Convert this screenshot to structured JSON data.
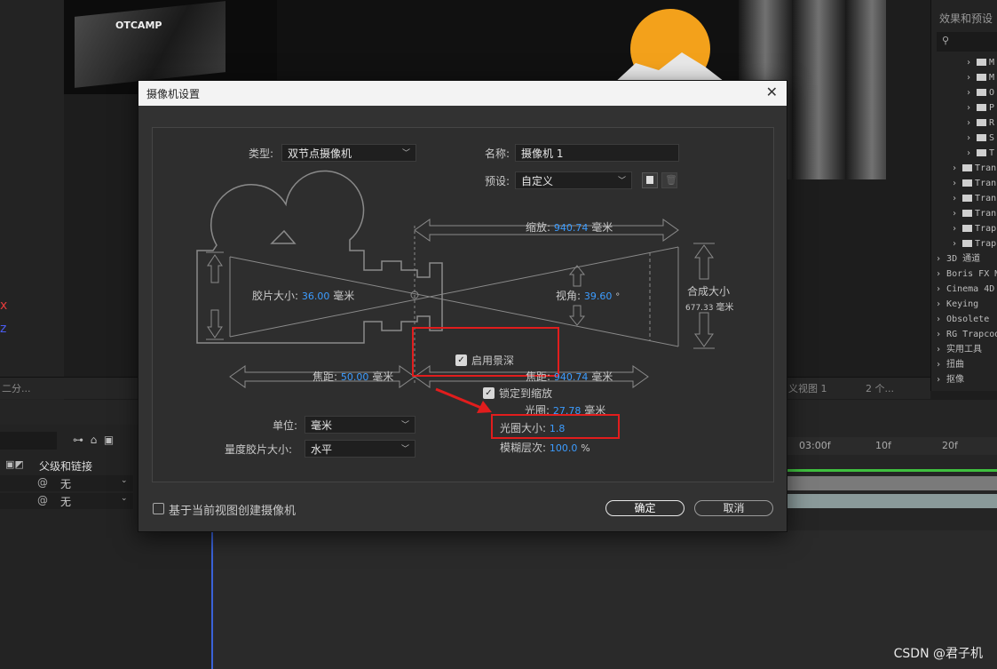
{
  "background": {
    "thumb_logo": "OTCAMP",
    "axis_x": "x",
    "axis_z": "z",
    "right_panel": {
      "title": "效果和预设",
      "items": [
        {
          "label": "M",
          "type": "folder"
        },
        {
          "label": "M",
          "type": "folder"
        },
        {
          "label": "O",
          "type": "folder"
        },
        {
          "label": "P",
          "type": "folder"
        },
        {
          "label": "R",
          "type": "folder"
        },
        {
          "label": "S",
          "type": "folder"
        },
        {
          "label": "T",
          "type": "folder"
        },
        {
          "label": "Tran",
          "type": "folder"
        },
        {
          "label": "Tran",
          "type": "folder"
        },
        {
          "label": "Tran",
          "type": "folder"
        },
        {
          "label": "Tran",
          "type": "folder"
        },
        {
          "label": "Trap",
          "type": "folder"
        },
        {
          "label": "Trap",
          "type": "folder"
        },
        {
          "label": "3D 通道",
          "type": "group"
        },
        {
          "label": "Boris FX M",
          "type": "group"
        },
        {
          "label": "Cinema 4D",
          "type": "group"
        },
        {
          "label": "Keying",
          "type": "group"
        },
        {
          "label": "Obsolete",
          "type": "group"
        },
        {
          "label": "RG Trapcode",
          "type": "group"
        },
        {
          "label": "实用工具",
          "type": "group"
        },
        {
          "label": "扭曲",
          "type": "group"
        },
        {
          "label": "抠像",
          "type": "group"
        }
      ]
    },
    "midbar": {
      "left_dropdown": "二分...",
      "view_dropdown": "义视图 1",
      "count_dropdown": "2 个..."
    },
    "timeline": {
      "column_header": "父级和链接",
      "rows": [
        "无",
        "无"
      ],
      "ruler": [
        "03:00f",
        "10f",
        "20f"
      ]
    },
    "watermark": "CSDN @君子机"
  },
  "dialog": {
    "title": "摄像机设置",
    "type_label": "类型:",
    "type_value": "双节点摄像机",
    "name_label": "名称:",
    "name_value": "摄像机 1",
    "preset_label": "预设:",
    "preset_value": "自定义",
    "zoom_label": "缩放:",
    "zoom_value": "940.74",
    "unit_mm": "毫米",
    "film_size_label": "胶片大小:",
    "film_size_value": "36.00",
    "angle_label": "视角:",
    "angle_value": "39.60",
    "angle_unit": "°",
    "comp_size_label": "合成大小",
    "comp_size_value": "677.33",
    "enable_dof_label": "启用景深",
    "enable_dof_checked": true,
    "focal_length_label": "焦距:",
    "focal_length_value": "50.00",
    "focus_distance_label": "焦距:",
    "focus_distance_value": "940.74",
    "lock_zoom_label": "锁定到缩放",
    "lock_zoom_checked": true,
    "aperture_label": "光圈:",
    "aperture_value": "27.78",
    "fstop_label": "光圈大小:",
    "fstop_value": "1.8",
    "blur_label": "模糊层次:",
    "blur_value": "100.0",
    "blur_unit": "%",
    "units_label": "单位:",
    "units_value": "毫米",
    "measure_label": "量度胶片大小:",
    "measure_value": "水平",
    "create_from_view_label": "基于当前视图创建摄像机",
    "create_from_view_checked": false,
    "ok_label": "确定",
    "cancel_label": "取消"
  },
  "colors": {
    "highlight_box": "#e11d1d",
    "value_blue": "#3c9cff",
    "arrow": "#e11d1d"
  }
}
